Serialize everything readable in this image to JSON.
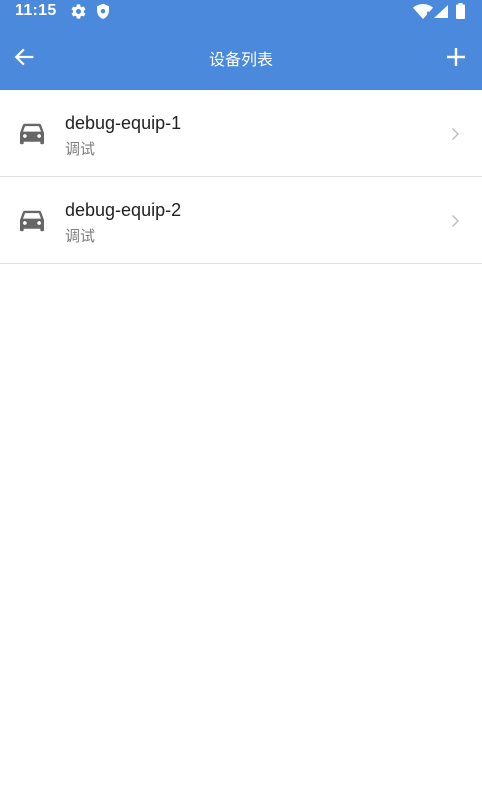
{
  "status_bar": {
    "time": "11:15",
    "icons": [
      "gear-icon",
      "shield-icon",
      "wifi-icon",
      "signal-icon",
      "battery-icon"
    ]
  },
  "app_bar": {
    "title": "设备列表",
    "back_icon": "arrow-left-icon",
    "add_icon": "plus-icon",
    "color": "#4a89dc"
  },
  "devices": [
    {
      "name": "debug-equip-1",
      "subtitle": "调试",
      "icon": "car-icon"
    },
    {
      "name": "debug-equip-2",
      "subtitle": "调试",
      "icon": "car-icon"
    }
  ]
}
